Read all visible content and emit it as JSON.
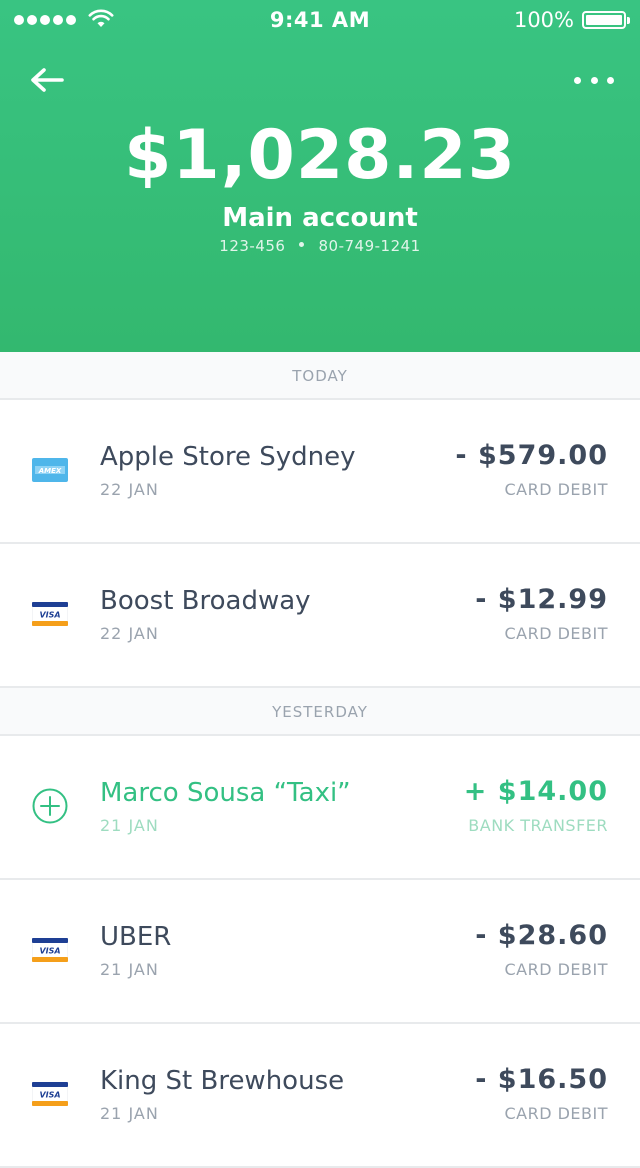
{
  "status_bar": {
    "time": "9:41 AM",
    "battery": "100%"
  },
  "header": {
    "balance": "$1,028.23",
    "account_name": "Main account",
    "bsb": "123-456",
    "account_number": "80-749-1241"
  },
  "icons": {
    "back": "arrow-left-icon",
    "more": "more-dots-icon",
    "amex": "amex-card-icon",
    "visa": "visa-card-icon",
    "plus": "plus-circle-icon"
  },
  "colors": {
    "header_green": "#35bd77",
    "credit_green": "#33c083",
    "text_dark": "#3e4a5c",
    "text_muted": "#9aa3ae"
  },
  "sections": [
    {
      "label": "TODAY",
      "transactions": [
        {
          "merchant": "Apple Store Sydney",
          "date": "22 JAN",
          "amount": "- $579.00",
          "type": "CARD DEBIT",
          "icon": "amex"
        },
        {
          "merchant": "Boost Broadway",
          "date": "22 JAN",
          "amount": "- $12.99",
          "type": "CARD DEBIT",
          "icon": "visa"
        }
      ]
    },
    {
      "label": "YESTERDAY",
      "transactions": [
        {
          "merchant": "Marco Sousa “Taxi”",
          "date": "21 JAN",
          "amount": "+ $14.00",
          "type": "BANK TRANSFER",
          "icon": "plus"
        },
        {
          "merchant": "UBER",
          "date": "21 JAN",
          "amount": "- $28.60",
          "type": "CARD DEBIT",
          "icon": "visa"
        },
        {
          "merchant": "King St Brewhouse",
          "date": "21 JAN",
          "amount": "- $16.50",
          "type": "CARD DEBIT",
          "icon": "visa"
        }
      ]
    }
  ]
}
